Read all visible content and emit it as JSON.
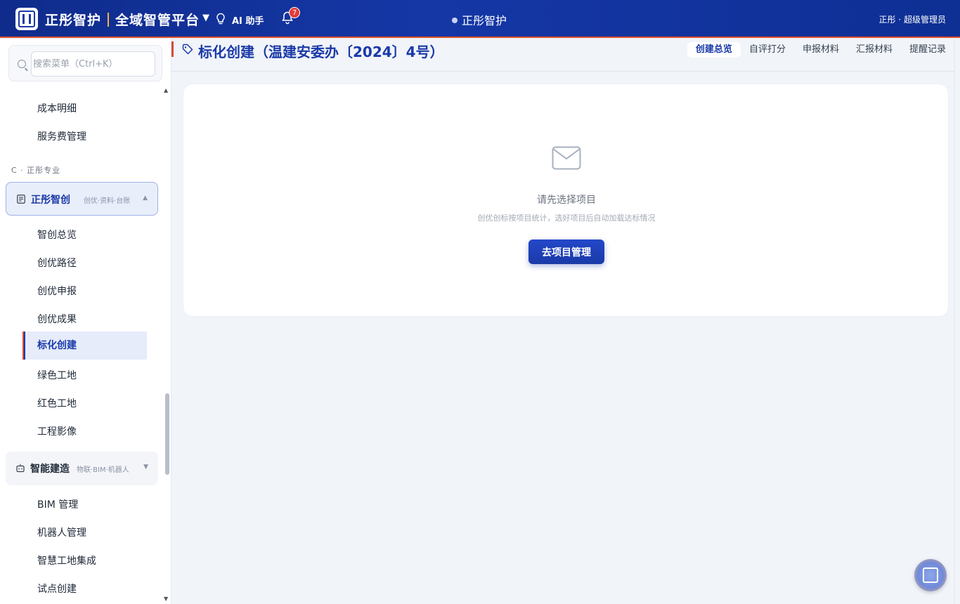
{
  "topbar": {
    "brand_name": "正彤智护",
    "platform_name": "全域智管平台",
    "ai_label": "AI 助手",
    "notification_count": "7",
    "center_title": "正彤智护",
    "user_label": "正彤 · 超级管理员"
  },
  "sidebar": {
    "search_placeholder": "搜索菜单（Ctrl+K）",
    "items_top": [
      "成本明细",
      "服务费管理"
    ],
    "section_label": "C · 正彤专业",
    "group1": {
      "title": "正彤智创",
      "subtitle": "创优·资料·台账"
    },
    "group1_items": [
      "智创总览",
      "创优路径",
      "创优申报",
      "创优成果",
      "标化创建",
      "绿色工地",
      "红色工地",
      "工程影像"
    ],
    "active_item": "标化创建",
    "group2": {
      "title": "智能建造",
      "subtitle": "物联·BIM·机器人"
    },
    "group2_items": [
      "BIM 管理",
      "机器人管理",
      "智慧工地集成",
      "试点创建"
    ]
  },
  "main": {
    "page_title": "标化创建（温建安委办〔2024〕4号）",
    "tabs": [
      {
        "label": "创建总览",
        "active": true
      },
      {
        "label": "自评打分",
        "active": false
      },
      {
        "label": "申报材料",
        "active": false
      },
      {
        "label": "汇报材料",
        "active": false
      },
      {
        "label": "提醒记录",
        "active": false
      }
    ],
    "empty_title": "请先选择项目",
    "empty_subtitle": "创优创标按项目统计，选好项目后自动加载达标情况",
    "action_button": "去项目管理"
  },
  "colors": {
    "primary": "#1a3aa8",
    "accent_red": "#d64a3b",
    "topbar_bg": "#1537a6",
    "page_bg": "#f1f4f9"
  },
  "icons": [
    "logo-icon",
    "chevron-down-icon",
    "lightbulb-icon",
    "bell-icon",
    "search-icon",
    "document-icon",
    "robot-icon",
    "tag-icon",
    "mail-icon",
    "assistant-float-icon"
  ]
}
